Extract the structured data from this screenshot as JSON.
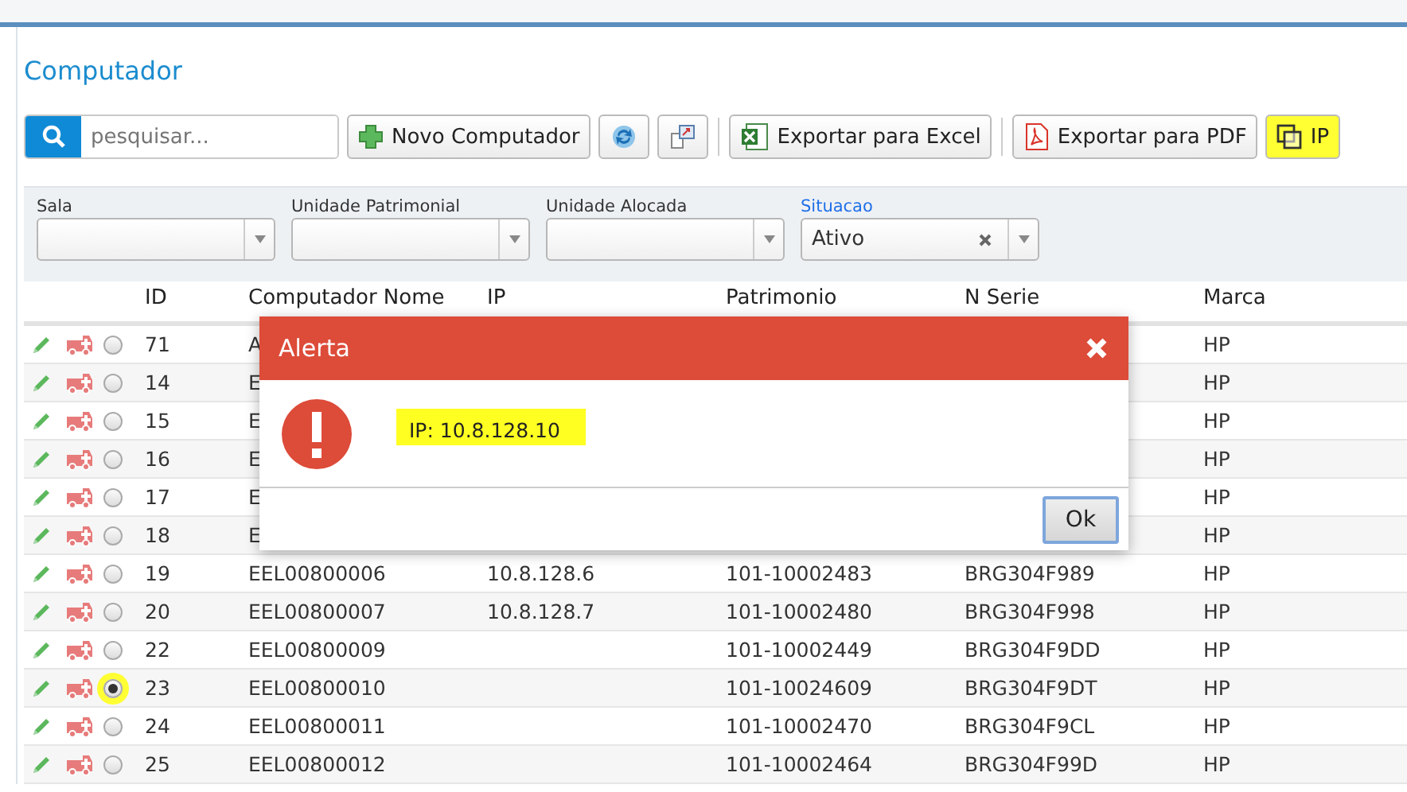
{
  "page": {
    "title": "Computador"
  },
  "toolbar": {
    "search": {
      "placeholder": "pesquisar..."
    },
    "buttons": [
      {
        "kind": "add",
        "label": "Novo Computador",
        "highlighted": false
      },
      {
        "kind": "refresh"
      },
      {
        "kind": "export"
      },
      {
        "kind": "excel",
        "label": "Exportar para Excel",
        "highlighted": false
      },
      {
        "kind": "pdf",
        "label": "Exportar para PDF",
        "highlighted": false
      },
      {
        "kind": "copy",
        "label": "IP",
        "highlighted": true
      }
    ]
  },
  "filters": [
    {
      "label": "Sala",
      "active": false,
      "clearable": false
    },
    {
      "label": "Unidade Patrimonial",
      "active": false,
      "clearable": false
    },
    {
      "label": "Unidade Alocada",
      "active": false,
      "clearable": false
    },
    {
      "label": "Situacao",
      "value": "Ativo",
      "active": true,
      "clearable": true
    }
  ],
  "table": {
    "columns": [
      "ID",
      "Computador Nome",
      "IP",
      "Patrimonio",
      "N Serie",
      "Marca"
    ],
    "rows": [
      {
        "selected": false,
        "highlighted": false,
        "cells": [
          "71",
          "A",
          "",
          "",
          "",
          "HP"
        ]
      },
      {
        "selected": false,
        "highlighted": false,
        "cells": [
          "14",
          "E",
          "",
          "",
          "",
          "HP"
        ]
      },
      {
        "selected": false,
        "highlighted": false,
        "cells": [
          "15",
          "E",
          "",
          "",
          "",
          "HP"
        ]
      },
      {
        "selected": false,
        "highlighted": false,
        "cells": [
          "16",
          "E",
          "",
          "",
          "",
          "HP"
        ]
      },
      {
        "selected": false,
        "highlighted": false,
        "cells": [
          "17",
          "E",
          "",
          "",
          "",
          "HP"
        ]
      },
      {
        "selected": false,
        "highlighted": false,
        "cells": [
          "18",
          "E",
          "",
          "",
          "",
          "HP"
        ]
      },
      {
        "selected": false,
        "highlighted": false,
        "cells": [
          "19",
          "EEL00800006",
          "10.8.128.6",
          "101-10002483",
          "BRG304F989",
          "HP"
        ]
      },
      {
        "selected": false,
        "highlighted": false,
        "cells": [
          "20",
          "EEL00800007",
          "10.8.128.7",
          "101-10002480",
          "BRG304F998",
          "HP"
        ]
      },
      {
        "selected": false,
        "highlighted": false,
        "cells": [
          "22",
          "EEL00800009",
          "",
          "101-10002449",
          "BRG304F9DD",
          "HP"
        ]
      },
      {
        "selected": true,
        "highlighted": true,
        "cells": [
          "23",
          "EEL00800010",
          "",
          "101-10024609",
          "BRG304F9DT",
          "HP"
        ]
      },
      {
        "selected": false,
        "highlighted": false,
        "cells": [
          "24",
          "EEL00800011",
          "",
          "101-10002470",
          "BRG304F9CL",
          "HP"
        ]
      },
      {
        "selected": false,
        "highlighted": false,
        "cells": [
          "25",
          "EEL00800012",
          "",
          "101-10002464",
          "BRG304F99D",
          "HP"
        ]
      }
    ]
  },
  "dialog": {
    "title": "Alerta",
    "message": "IP: 10.8.128.10",
    "message_highlighted": true,
    "button": "Ok"
  }
}
